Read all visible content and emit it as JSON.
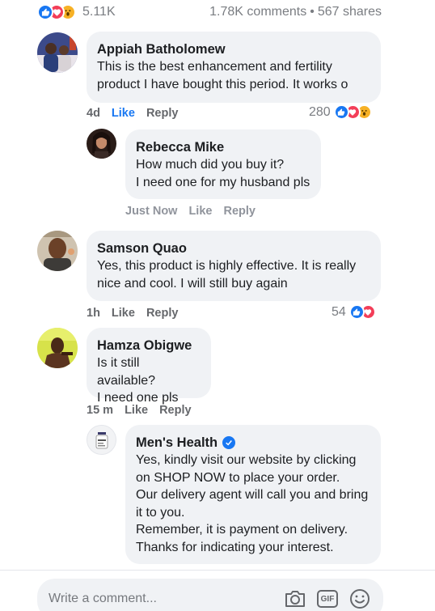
{
  "post_stats": {
    "reaction_count": "5.11K",
    "comments": "1.78K comments",
    "separator": "•",
    "shares": "567 shares"
  },
  "comments": [
    {
      "name": "Appiah Batholomew",
      "text": "This is the best enhancement and fertility\nproduct I have bought this period. It works o",
      "time": "4d",
      "like": "Like",
      "reply": "Reply",
      "reaction_count": "280",
      "liked": true
    },
    {
      "name": "Rebecca Mike",
      "text": "How much did you buy it?\nI need one for my husband pls",
      "time": "Just Now",
      "like": "Like",
      "reply": "Reply"
    },
    {
      "name": "Samson Quao",
      "text": "Yes, this product is highly effective. It is really\nnice and cool. I will still buy again",
      "time": "1h",
      "like": "Like",
      "reply": "Reply",
      "reaction_count": "54"
    },
    {
      "name": "Hamza Obigwe",
      "text": "Is it still available?\nI need one pls",
      "time": "15 m",
      "like": "Like",
      "reply": "Reply"
    },
    {
      "name": "Men's Health",
      "text": "Yes, kindly visit our website by clicking\non SHOP NOW to place your order.\nOur delivery agent will call you and bring\nit to you.\nRemember, it is payment on delivery.\nThanks for indicating your interest.",
      "verified": true
    }
  ],
  "composer": {
    "placeholder": "Write a comment..."
  },
  "colors": {
    "accent": "#1877f2",
    "bubble": "#f0f2f5",
    "love": "#f33e58",
    "wow": "#f7b125"
  },
  "icons": [
    "like-reaction-icon",
    "love-reaction-icon",
    "wow-reaction-icon",
    "verified-badge-icon",
    "camera-icon",
    "gif-icon",
    "emoji-icon"
  ]
}
